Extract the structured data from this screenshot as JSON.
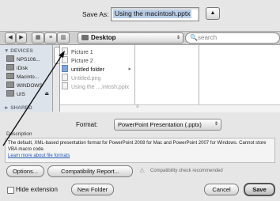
{
  "save_row": {
    "label": "Save As:",
    "filename": "Using the macintosh.pptx",
    "expand_glyph": "▲"
  },
  "toolbar": {
    "back_glyph": "◀",
    "forward_glyph": "▶",
    "view_icons": "▦",
    "view_list": "≡",
    "view_columns": "▥",
    "location": "Desktop",
    "location_arrow": "⇕",
    "search_glyph": "🔍",
    "search_placeholder": "search"
  },
  "sidebar": {
    "devices_heading": "▼ DEVICES",
    "items": [
      {
        "label": "NPS106..."
      },
      {
        "label": "iDisk"
      },
      {
        "label": "Macinto..."
      },
      {
        "label": "WINDOWS"
      },
      {
        "label": "UIS"
      }
    ],
    "eject_glyph": "⏏",
    "shared_heading": "► SHARED"
  },
  "files": [
    {
      "label": "Picture 1",
      "kind": "image"
    },
    {
      "label": "Picture 2",
      "kind": "image"
    },
    {
      "label": "untitled folder",
      "kind": "folder",
      "chevron": "▸"
    },
    {
      "label": "Untitled.png",
      "kind": "image"
    },
    {
      "label": "Using the ....intosh.pptx",
      "kind": "doc"
    }
  ],
  "format": {
    "label": "Format:",
    "value": "PowerPoint Presentation (.pptx)",
    "arrow": "⇕"
  },
  "description": {
    "label": "Description",
    "text": "The default, XML-based presentation format for PowerPoint 2008 for Mac and PowerPoint 2007 for Windows. Cannot store VBA macro code.",
    "link": "Learn more about file formats"
  },
  "options_button": "Options...",
  "compat_button": "Compatibility Report...",
  "compat_warning_glyph": "⚠",
  "compat_text": "Compatibility check recommended",
  "hide_extension": "Hide extension",
  "new_folder_button": "New Folder",
  "cancel_button": "Cancel",
  "save_button": "Save"
}
